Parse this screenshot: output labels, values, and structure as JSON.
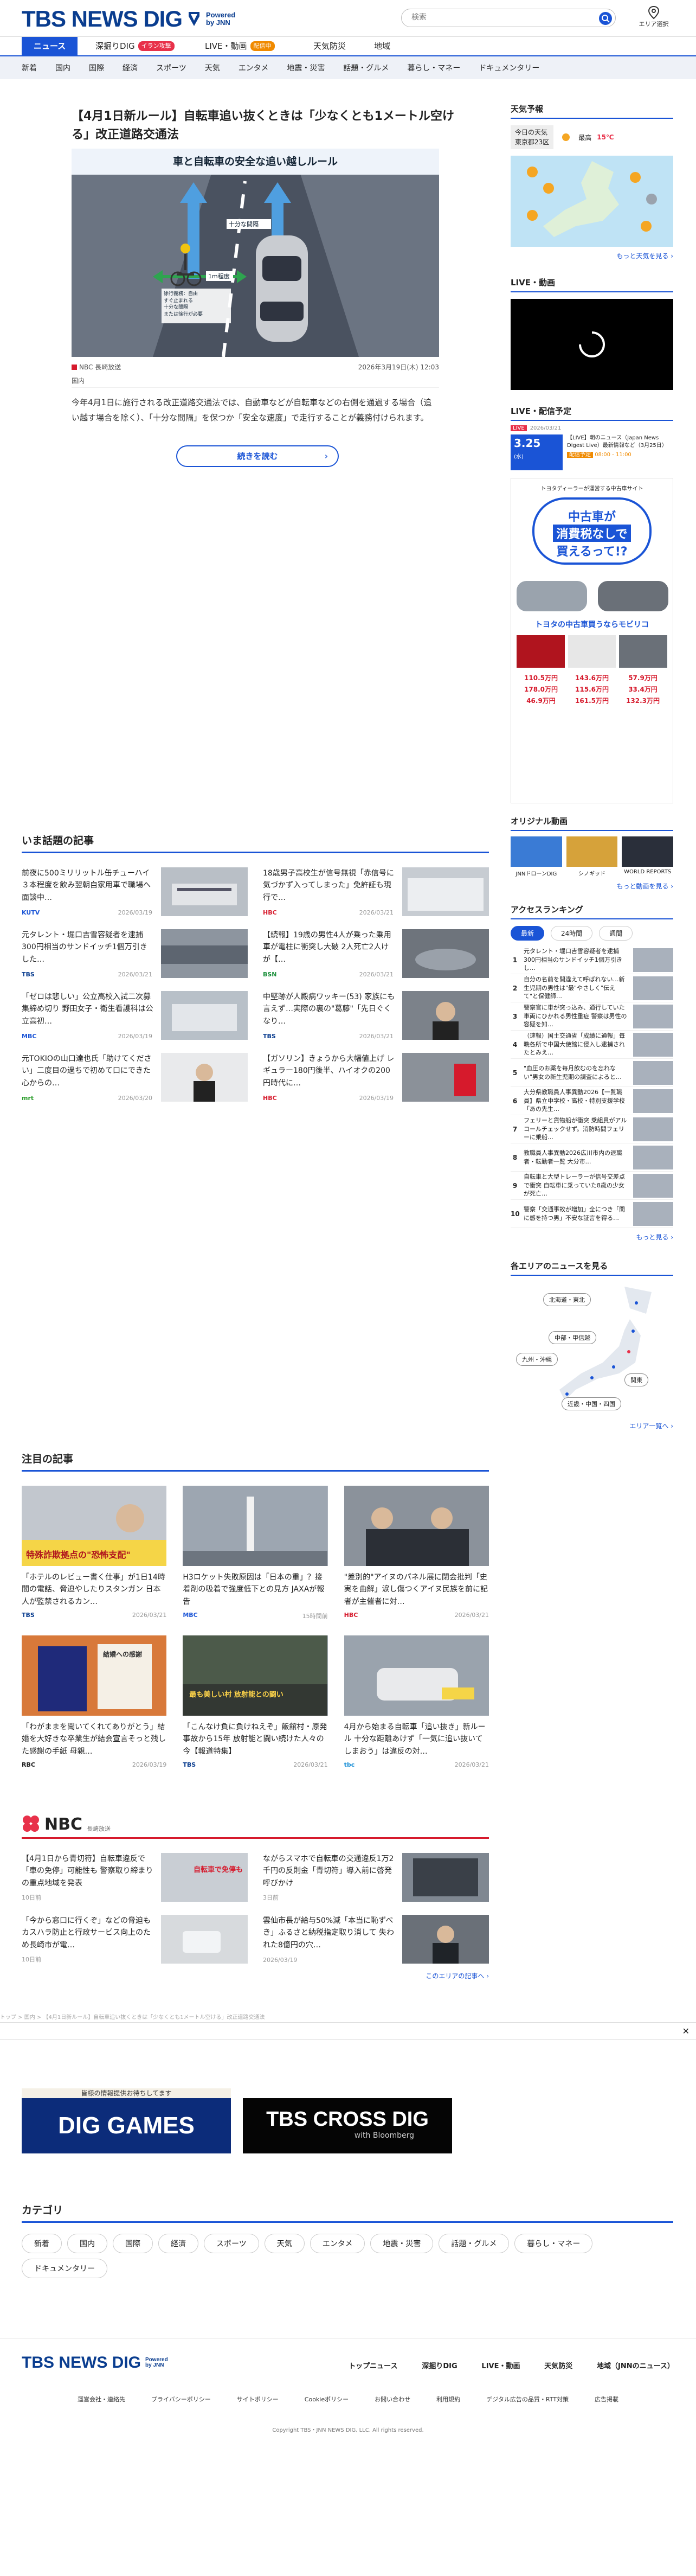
{
  "header": {
    "logo_main": "TBS NEWS DIG",
    "logo_powered": "Powered",
    "logo_by": "by JNN",
    "search_placeholder": "検索",
    "area_select_label": "エリア選択"
  },
  "nav_primary": [
    {
      "label": "ニュース",
      "active": true
    },
    {
      "label": "深掘りDIG",
      "badge": "イラン攻撃",
      "badge_color": "#e8314a"
    },
    {
      "label": "LIVE・動画",
      "badge": "配信中",
      "badge_color": "#f08a00"
    },
    {
      "label": "天気防災"
    },
    {
      "label": "地域"
    }
  ],
  "nav_secondary": [
    "新着",
    "国内",
    "国際",
    "経済",
    "スポーツ",
    "天気",
    "エンタメ",
    "地震・災害",
    "話題・グルメ",
    "暮らし・マネー",
    "ドキュメンタリー"
  ],
  "hero": {
    "title": "【4月1日新ルール】自転車追い抜くときは「少なくとも1メートル空ける」改正道路交通法",
    "image_caption": "車と自転車の安全な追い越しルール",
    "image_label_1": "十分な間隔",
    "image_label_2": "1m程度",
    "image_label_3": "徐行義務：自由\nすぐ止まれる\n十分な間隔\nまたは徐行が必要",
    "source": "NBC 長崎放送",
    "date": "2026年3月19日(木) 12:03",
    "tag": "国内",
    "description": "今年4月1日に施行される改正道路交通法では、自動車などが自転車などの右側を通過する場合（追い越す場合を除く）、「十分な間隔」を保つか「安全な速度」で走行することが義務付けられます。",
    "read_more": "続きを読む"
  },
  "trending": {
    "title": "いま話題の記事",
    "items": [
      {
        "title": "前夜に500ミリリットル缶チューハイ３本程度を飲み翌朝自家用車で職場へ 面談中…",
        "source": "KUTV",
        "source_color": "#1a54d6",
        "date": "2026/03/19"
      },
      {
        "title": "18歳男子高校生が信号無視「赤信号に気づかず入ってしまった」免許証も現行で…",
        "source": "HBC",
        "source_color": "#d61a2c",
        "date": "2026/03/21"
      },
      {
        "title": "元タレント・堀口吉雪容疑者を逮捕 300円相当のサンドイッチ1個万引きした…",
        "source": "TBS",
        "source_color": "#0a3d8f",
        "date": "2026/03/21"
      },
      {
        "title": "【続報】19歳の男性4人が乗った乗用車が電柱に衝突し大破 2人死亡2人けが【…",
        "source": "BSN",
        "source_color": "#1a8f3a",
        "date": "2026/03/21"
      },
      {
        "title": "「ゼロは悲しい」公立高校入試二次募集締め切り 野田女子・衛生看護科は公立高初…",
        "source": "MBC",
        "source_color": "#1a54d6",
        "date": "2026/03/19"
      },
      {
        "title": "中堅跡が人殿病ワッキー(53) 家族にも言えず…実際の裏の\"葛藤\"「先日ぐくなり…",
        "source": "TBS",
        "source_color": "#0a3d8f",
        "date": "2026/03/21"
      },
      {
        "title": "元TOKIOの山口達也氏「助けてください」二度目の過ちで初めて口にできた心からの…",
        "source": "mrt",
        "source_color": "#2a9d2a",
        "date": "2026/03/20"
      },
      {
        "title": "【ガソリン】きょうから大幅値上げ レギュラー180円後半、ハイオクの200円時代に…",
        "source": "HBC",
        "source_color": "#d61a2c",
        "date": "2026/03/19"
      }
    ]
  },
  "featured": {
    "title": "注目の記事",
    "items": [
      {
        "title": "「ホテルのレビュー書く仕事」が1日14時間の電話、脅迫やしたりスタンガン 日本人が監禁されるカン…",
        "source": "TBS",
        "source_color": "#0a3d8f",
        "date": "2026/03/21",
        "thumb_text": "特殊詐欺拠点の\"恐怖支配\""
      },
      {
        "title": "H3ロケット失敗原因は「日本の重」？接着剤の吸着で強度低下との見方 JAXAが報告",
        "source": "MBC",
        "source_color": "#1a54d6",
        "date": "15時間前",
        "thumb_text": ""
      },
      {
        "title": "\"差別的\"アイヌのパネル展に閉会批判「史実を曲解」涙し傷つくアイヌ民族を前に記者が主催者に対…",
        "source": "HBC",
        "source_color": "#d61a2c",
        "date": "2026/03/21",
        "thumb_text": ""
      },
      {
        "title": "「わがままを聞いてくれてありがとう」結婚を大好きな卒業生が結会宣言そっと残した感謝の手紙 母親…",
        "source": "RBC",
        "source_color": "#222222",
        "date": "2026/03/19",
        "thumb_text": "結婚への感謝"
      },
      {
        "title": "「こんなけ負に負けねえぞ」飯舘村・原発事故から15年 放射能と闘い続けた人々の今【報道特集】",
        "source": "TBS",
        "source_color": "#0a3d8f",
        "date": "2026/03/21",
        "thumb_text": "最も美しい村 放射能との闘い"
      },
      {
        "title": "4月から始まる自転車「追い抜き」新ルール 十分な距離あけず「一気に追い抜いてしまおう」は違反の対…",
        "source": "tbc",
        "source_color": "#1a8fd6",
        "date": "2026/03/21",
        "thumb_text": ""
      }
    ]
  },
  "nbc_block": {
    "logo": "NBC",
    "label": "長崎放送",
    "items": [
      {
        "title": "【4月1日から青切符】自転車違反で「車の免停」可能性も 警察取り締まりの重点地域を発表",
        "date": "10日前",
        "thumb_text": "自転車で免停も"
      },
      {
        "title": "ながらスマホで自転車の交通違反1万2千円の反則金「青切符」導入前に啓発呼びかけ",
        "date": "3日前",
        "thumb_text": ""
      },
      {
        "title": "「今から窓口に行くぞ」などの脅迫も カスハラ防止と行政サービス向上のため長崎市が電…",
        "date": "10日前",
        "thumb_text": ""
      },
      {
        "title": "雲仙市長が給与50%減「本当に恥ずべき」ふるさと納税指定取り消して 失われた8億円の穴…",
        "date": "2026/03/19",
        "thumb_text": ""
      }
    ],
    "more": "このエリアの記事へ ›"
  },
  "breadcrumb": "トップ > 国内 > 【4月1日新ルール】自転車追い抜くときは「少なくとも1メートル空ける」改正道路交通法",
  "promo": {
    "left_title": "DIG GAMES",
    "left_strip": "皆様の情報提供お待ちしてます",
    "right_title": "TBS CROSS DIG",
    "right_sub": "with Bloomberg"
  },
  "categories": {
    "title": "カテゴリ",
    "items": [
      "新着",
      "国内",
      "国際",
      "経済",
      "スポーツ",
      "天気",
      "エンタメ",
      "地震・災害",
      "話題・グルメ",
      "暮らし・マネー",
      "ドキュメンタリー"
    ]
  },
  "footer": {
    "nav": [
      "トップニュース",
      "深掘りDIG",
      "LIVE・動画",
      "天気防災",
      "地域（JNNのニュース）"
    ],
    "links": [
      "運営会社・連絡先",
      "プライバシーポリシー",
      "サイトポリシー",
      "Cookieポリシー",
      "お問い合わせ",
      "利用規約",
      "デジタル広告の品質・RTT対策",
      "広告掲載"
    ],
    "copyright": "Copyright TBS・JNN NEWS DIG, LLC. All rights reserved."
  },
  "sidebar": {
    "weather": {
      "title": "天気予報",
      "today": "今日の天気",
      "place": "東京都23区",
      "label": "最高",
      "temp": "15℃",
      "more": "もっと天気を見る ›"
    },
    "live": {
      "title": "LIVE・動画"
    },
    "live_now": {
      "title": "LIVE・配信予定",
      "badge": "LIVE",
      "date": "2026/03/21",
      "card_date": "3.25",
      "card_day": "(水)",
      "card_title": "【LIVE】朝のニュース（Japan News Digest Live）最新情報など（3月25日）",
      "card_badge": "配信予定",
      "card_time": "08:00 - 11:00"
    },
    "ad": {
      "brand": "トヨタディーラーが運営する中古車サイト",
      "headline1": "中古車が",
      "headline2": "消費税なしで",
      "headline3": "買えるって!?",
      "tagline": "トヨタの中古車買うならモビリコ",
      "prices": [
        "110.5万円",
        "143.6万円",
        "57.9万円",
        "178.0万円",
        "115.6万円",
        "33.4万円",
        "46.9万円",
        "161.5万円",
        "132.3万円"
      ]
    },
    "original": {
      "title": "オリジナル動画",
      "items": [
        "JNNドローンDIG",
        "シノギッド",
        "WORLD REPORTS"
      ],
      "more": "もっと動画を見る ›"
    },
    "ranking": {
      "title": "アクセスランキング",
      "tabs": [
        "最新",
        "24時間",
        "週間"
      ],
      "items": [
        "元タレント・堀口吉雪容疑者を逮捕 300円相当のサンドイッチ1個万引きし…",
        "自分の名前を間違えて呼ばれない…新生児期の男性は\"最\"やさしく\"伝えて\"と保健師…",
        "警察官に車が突っ込み、通行していた車両にひかれる男性重症 警察は男性の容疑を知…",
        "（速報）国土交通省「成績に通報」毎晩各所で中国大使館に侵入し逮捕されたとみえ…",
        "\"血圧のお薬を毎月飲むのを忘れない\"男女の新生児期の調査によると…",
        "大分県教職員人事異動2026【一覧職員】県立中学校・高校・特別支援学校「あの先生…",
        "フェリーと貨物船が衝突 乗組員がアルコールチェックせず。消防時間フェリーに乗船…",
        "教職員人事異動2026広川市内の退職者・転勤者一覧 大分市…",
        "自転車と大型トレーラーが信号交差点で衝突 自転車に乗っていた8歳の少女が死亡…",
        "警察「交通事故が増加」全につき「間に感を持つ男」不安な証言を得る…"
      ],
      "more": "もっと見る ›"
    },
    "area": {
      "title": "各エリアのニュースを見る",
      "regions": [
        "北海道・東北",
        "中部・甲信越",
        "九州・沖縄",
        "関東",
        "近畿・中国・四国"
      ],
      "more": "エリア一覧へ ›"
    }
  }
}
